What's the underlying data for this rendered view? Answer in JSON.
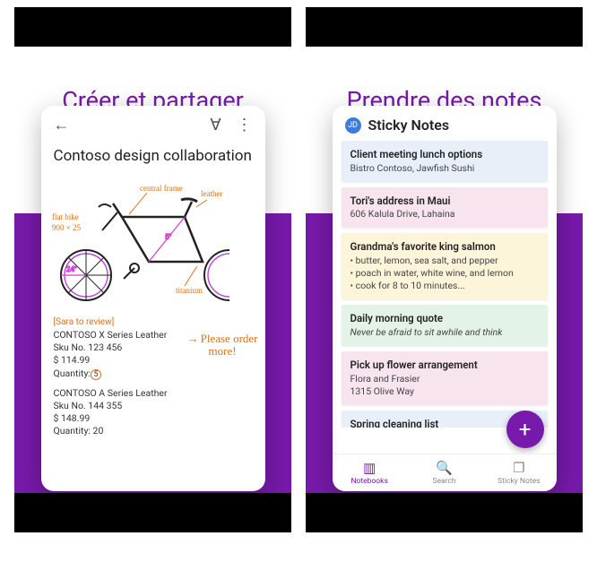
{
  "left": {
    "headline": "Créer et partager",
    "note_title": "Contoso design collaboration",
    "annotations": {
      "flat_bike": "flat bike",
      "dims": "900 × 25",
      "wheel_diam": "24\"",
      "central_frame": "central frame",
      "leather": "leather",
      "titanium": "titanium",
      "small_dim": "5\""
    },
    "review_tag": "[Sara to review]",
    "product1": {
      "name": "CONTOSO X Series Leather",
      "sku": "Sku No. 123 456",
      "price": "$ 114.99",
      "qty_label": "Quantity:",
      "qty": "5"
    },
    "handwriting": "Please order\nmore!",
    "product2": {
      "name": "CONTOSO A Series Leather",
      "sku": "Sku No. 144 355",
      "price": "$ 148.99",
      "qty": "Quantity: 20"
    }
  },
  "right": {
    "headline": "Prendre des notes",
    "avatar_initials": "JD",
    "sticky_title": "Sticky Notes",
    "notes": [
      {
        "color": "#e8eff9",
        "title": "Client meeting lunch options",
        "body": "Bistro Contoso, Jawfish Sushi"
      },
      {
        "color": "#f7e4ee",
        "title": "Tori's address in Maui",
        "body": "606 Kalula Drive, Lahaina"
      },
      {
        "color": "#fdf5d9",
        "title": "Grandma's favorite king salmon",
        "body": "• butter, lemon, sea salt, and pepper\n• poach in water, white wine, and lemon\n• cook for 8 to 10 minutes..."
      },
      {
        "color": "#e4f3e8",
        "title": "Daily morning quote",
        "body": "Never be afraid to sit awhile and think",
        "italic": true
      },
      {
        "color": "#f7e4ee",
        "title": "Pick up flower arrangement",
        "body": "Flora and Frasier\n1315 Olive Way"
      },
      {
        "color": "#e8eff9",
        "title": "Spring cleaning list",
        "body": ""
      }
    ],
    "nav": {
      "notebooks": "Notebooks",
      "search": "Search",
      "sticky": "Sticky Notes"
    }
  }
}
